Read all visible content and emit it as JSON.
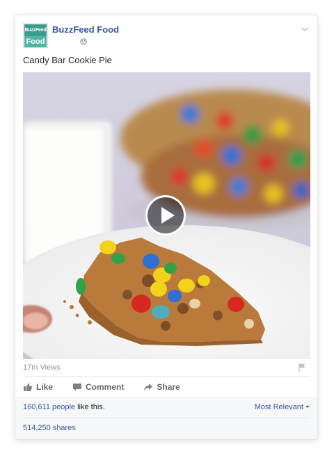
{
  "post": {
    "page_name": "BuzzFeed Food",
    "logo_top": "BuzzFeed",
    "logo_bottom": "Food",
    "meta_separator": "·",
    "text": "Candy Bar Cookie Pie"
  },
  "video": {
    "icon": "play-icon"
  },
  "stats": {
    "views": "17m Views",
    "likes_count": "160,611 people",
    "likes_suffix": " like this.",
    "sort_label": "Most Relevant",
    "shares": "514,250 shares"
  },
  "actions": {
    "like": "Like",
    "comment": "Comment",
    "share": "Share"
  },
  "colors": {
    "link": "#365899",
    "muted": "#90949c",
    "action": "#616770",
    "brand_teal": "#4cb6a4"
  }
}
